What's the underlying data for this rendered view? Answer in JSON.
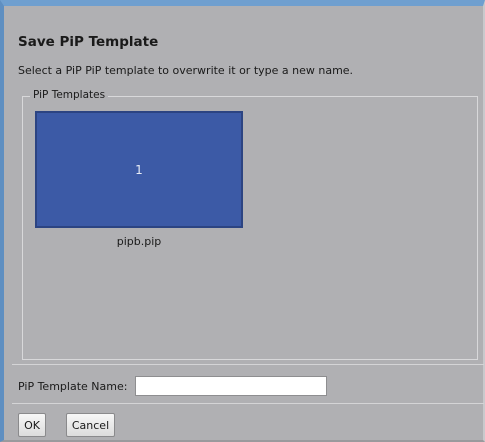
{
  "dialog": {
    "title": "Save PiP Template",
    "description": "Select a PiP PiP template to overwrite it or type a new name."
  },
  "templates": {
    "legend": "PiP Templates",
    "items": [
      {
        "number": "1",
        "filename": "pipb.pip",
        "color": "#3c5aa6"
      }
    ]
  },
  "name_field": {
    "label": "PiP Template Name:",
    "value": "",
    "placeholder": ""
  },
  "buttons": {
    "ok": "OK",
    "cancel": "Cancel"
  }
}
